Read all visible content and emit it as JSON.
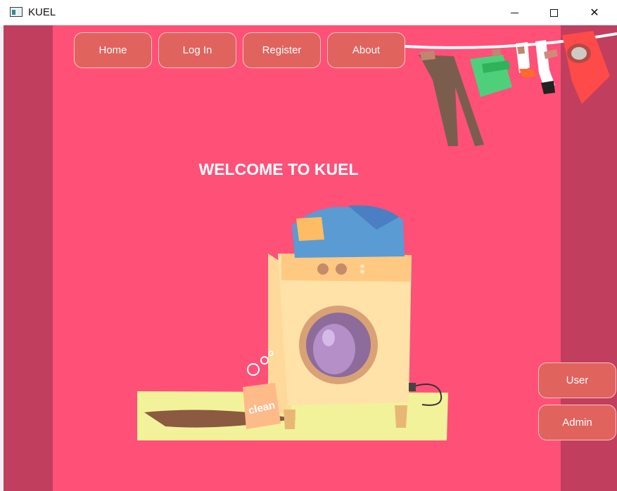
{
  "window": {
    "title": "KUEL",
    "controls": {
      "minimize": "minimize",
      "maximize": "maximize",
      "close": "✕"
    }
  },
  "nav": {
    "home": "Home",
    "login": "Log In",
    "register": "Register",
    "about": "About"
  },
  "main": {
    "welcome": "WELCOME TO KUEL",
    "box_label": "clean"
  },
  "side": {
    "user": "User",
    "admin": "Admin"
  },
  "colors": {
    "background": "#c13e5e",
    "panel": "#ff5078",
    "button": "#e0635d",
    "text": "#ffffff"
  },
  "icons": {
    "app": "window-icon",
    "close": "close-icon",
    "maximize": "maximize-icon",
    "minimize": "minimize-icon"
  }
}
